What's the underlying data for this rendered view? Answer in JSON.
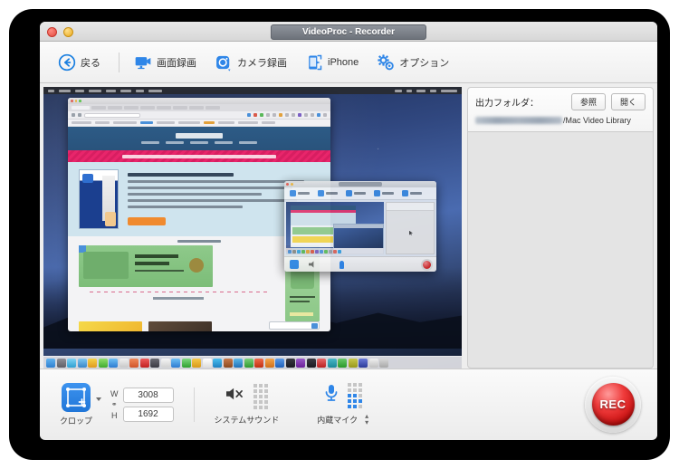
{
  "window": {
    "title": "VideoProc - Recorder",
    "traffic_lights": [
      "close",
      "minimize"
    ]
  },
  "toolbar": {
    "back": {
      "label": "戻る",
      "icon": "back-arrow-icon"
    },
    "items": [
      {
        "label": "画面録画",
        "icon": "screen-record-icon"
      },
      {
        "label": "カメラ録画",
        "icon": "camera-record-icon"
      },
      {
        "label": "iPhone",
        "icon": "iphone-icon"
      },
      {
        "label": "オプション",
        "icon": "gear-icon"
      }
    ]
  },
  "output": {
    "label": "出力フォルダ：",
    "browse_label": "参照",
    "open_label": "開く",
    "path_suffix": "/Mac Video Library",
    "path_redacted": true
  },
  "bottom": {
    "crop": {
      "caption": "クロップ",
      "icon": "crop-icon",
      "dropdown_icon": "caret-down-icon"
    },
    "dimensions": {
      "width_label": "W",
      "height_label": "H",
      "link_icon": "chain-link-icon",
      "width_value": "3008",
      "height_value": "1692"
    },
    "system_sound": {
      "caption": "システムサウンド",
      "icon": "speaker-muted-icon",
      "muted": true,
      "meter_active": false
    },
    "microphone": {
      "caption": "内蔵マイク",
      "icon": "microphone-icon",
      "meter_active": true,
      "stepper_icon": "stepper-updown-icon"
    },
    "record": {
      "label": "REC",
      "color": "#c40c0c"
    }
  },
  "preview": {
    "description": "mac-desktop-screen-preview",
    "browser_window": "safari-seo-website",
    "nested_window": "videoproc-recorder-recursive"
  },
  "colors": {
    "accent": "#2f86e8",
    "record_red": "#c40c0c",
    "titlebar": "#d7d7d7",
    "panel_bg": "#e4e4e4"
  }
}
